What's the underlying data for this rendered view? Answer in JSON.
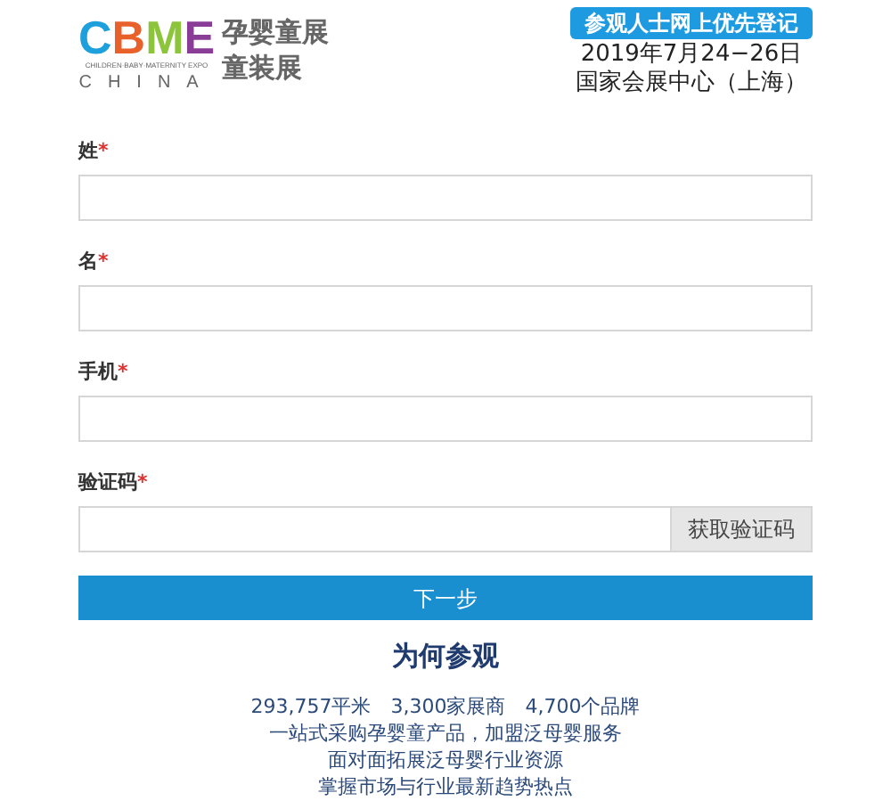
{
  "logo": {
    "letters": [
      {
        "text": "C",
        "color": "#1ea0dc"
      },
      {
        "text": "B",
        "color": "#e8602a"
      },
      {
        "text": "M",
        "color": "#8cc43c"
      },
      {
        "text": "E",
        "color": "#8a3d96"
      }
    ],
    "tagline": "CHILDREN·BABY·MATERNITY EXPO",
    "country": "CHINA",
    "title_lines": [
      "孕婴童展",
      "童装展"
    ]
  },
  "header": {
    "badge": "参观人士网上优先登记",
    "date": "2019年7月24−26日",
    "venue": "国家会展中心（上海）"
  },
  "fields": [
    {
      "label": "姓",
      "required_mark": "*",
      "kind": "text"
    },
    {
      "label": "名",
      "required_mark": "*",
      "kind": "text"
    },
    {
      "label": "手机",
      "required_mark": "*",
      "kind": "text"
    },
    {
      "label": "验证码",
      "required_mark": "*",
      "kind": "code",
      "button": "获取验证码"
    }
  ],
  "submit": "下一步",
  "why": {
    "title": "为何参观",
    "lines": [
      "293,757平米　3,300家展商　4,700个品牌",
      "一站式采购孕婴童产品，加盟泛母婴服务",
      "面对面拓展泛母婴行业资源",
      "掌握市场与行业最新趋势热点"
    ]
  }
}
